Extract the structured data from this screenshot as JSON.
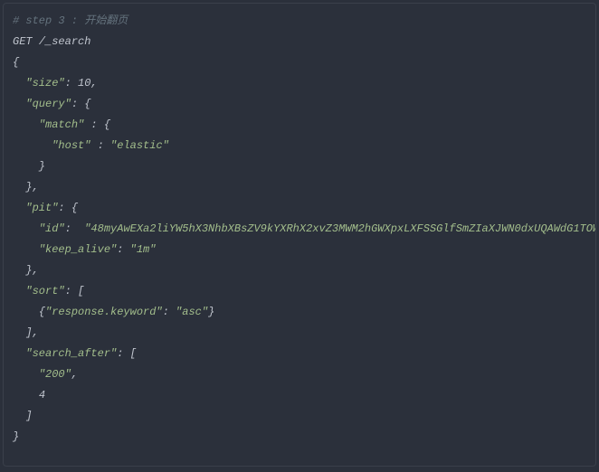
{
  "comment": "# step 3 : 开始翻页",
  "method": "GET",
  "path": "/_search",
  "body": {
    "size": 10,
    "query": {
      "match": {
        "host": "elastic"
      }
    },
    "pit": {
      "id": "48myAwEXa2liYW5hX3NhbXBsZV9kYXRhX2xvZ3MWM2hGWXpxLXFSSGlfSmZIaXJWN0dxUQAWdG1TOW",
      "keep_alive": "1m"
    },
    "sort": [
      {
        "response.keyword": "asc"
      }
    ],
    "search_after": [
      "200",
      4
    ]
  },
  "strings": {
    "size_key": "\"size\"",
    "size_val": "10",
    "query_key": "\"query\"",
    "match_key": "\"match\"",
    "host_key": "\"host\"",
    "host_val": "\"elastic\"",
    "pit_key": "\"pit\"",
    "id_key": "\"id\"",
    "id_val": "\"48myAwEXa2liYW5hX3NhbXBsZV9kYXRhX2xvZ3MWM2hGWXpxLXFSSGlfSmZIaXJWN0dxUQAWdG1TOW",
    "keep_alive_key": "\"keep_alive\"",
    "keep_alive_val": "\"1m\"",
    "sort_key": "\"sort\"",
    "resp_key": "\"response.keyword\"",
    "resp_val": "\"asc\"",
    "search_after_key": "\"search_after\"",
    "sa_val1": "\"200\"",
    "sa_val2": "4"
  }
}
